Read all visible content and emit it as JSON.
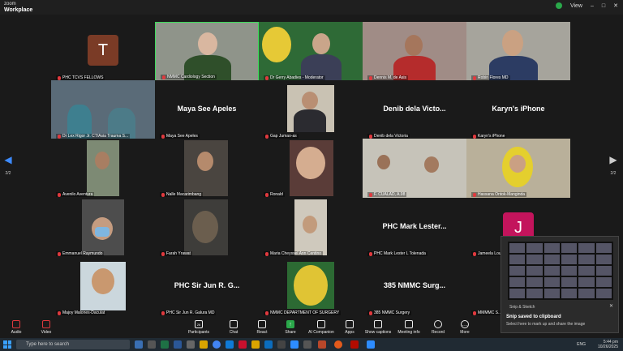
{
  "app": {
    "line1": "zoom",
    "line2": "Workplace",
    "view_label": "View"
  },
  "tiles": {
    "t1_initial": "T",
    "t1_name": "PHC TCVS FELLOWS",
    "t2_name": "NMMC Cardiology Section",
    "t3_name": "Dr Gerry Abadies - Moderator",
    "t4_name": "Dennis M. de Asis",
    "t5_name": "Robin Flores MD",
    "t6_name": "Dr Lex Rigor Jr. CT/Asia Trauma S...",
    "t7_title": "Maya See Apeles",
    "t7_name": "Maya See Apeles",
    "t8_name": "Gap Jumao-as",
    "t9_title": "Denib dela Victo...",
    "t9_name": "Denib dela Victoria",
    "t10_title": "Karyn's iPhone",
    "t10_name": "Karyn's iPhone",
    "t11_name": "Avenilo Aventura",
    "t12_name": "Nalle Macarimbang",
    "t13_name": "Ronald",
    "t14_name": "F. CUALAD, A.98",
    "t15_name": "Hassana Ontok-Manginda",
    "t16_name": "Emmanuel Raymundo",
    "t17_name": "Farah Yrawat",
    "t18_name": "Maria Cheyssel Ann Centino",
    "t19_title": "PHC Mark Lester...",
    "t19_name": "PHC Mark Lester L Tolenada",
    "t20_initial": "J",
    "t20_name": "Jameela Lou...",
    "t21_name": "Majoy Malones-Daculat",
    "t22_title": "PHC Sir Jun R. G...",
    "t22_name": "PHC Sir Jun R. Galura MD",
    "t23_name": "NMMC DEPARTMENT OF SURGERY",
    "t24_title": "385 NMMC Surg...",
    "t24_name": "385 NMMC Surgery",
    "t25_name": "MMMMC S..."
  },
  "pager": {
    "left": "2/2",
    "right": "2/2"
  },
  "toolbar": {
    "audio": "Audio",
    "video": "Video",
    "participants": "Participants",
    "participants_count": "26",
    "chat": "Chat",
    "react": "React",
    "share": "Share",
    "ai": "AI Companion",
    "apps": "Apps",
    "captions": "Show captions",
    "info": "Meeting info",
    "record": "Record",
    "more": "More"
  },
  "toast": {
    "app": "Snip & Sketch",
    "title": "Snip saved to clipboard",
    "body": "Select here to mark up and share the image"
  },
  "taskbar": {
    "search_placeholder": "Type here to search",
    "lang": "ENG",
    "time": "5:44 pm",
    "date": "10/26/2025"
  }
}
